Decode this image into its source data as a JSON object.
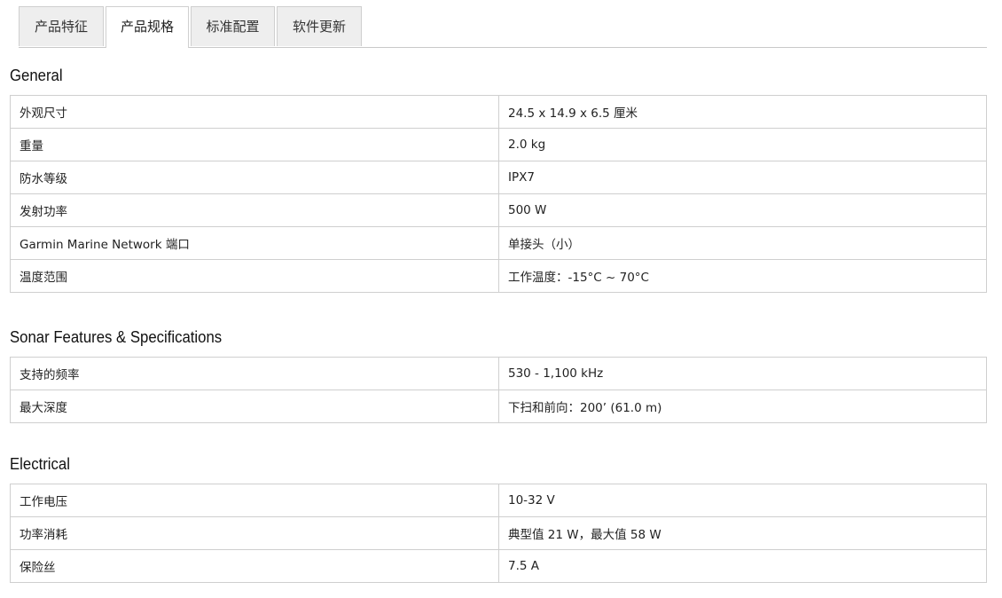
{
  "tabs": [
    {
      "label": "产品特征",
      "active": false
    },
    {
      "label": "产品规格",
      "active": true
    },
    {
      "label": "标准配置",
      "active": false
    },
    {
      "label": "软件更新",
      "active": false
    }
  ],
  "sections": [
    {
      "title": "General",
      "rows": [
        {
          "label": "外观尺寸",
          "value": "24.5 x 14.9 x 6.5 厘米"
        },
        {
          "label": "重量",
          "value": "2.0 kg"
        },
        {
          "label": "防水等级",
          "value": "IPX7"
        },
        {
          "label": "发射功率",
          "value": "500 W"
        },
        {
          "label": "Garmin Marine Network 端口",
          "value": "单接头（小）"
        },
        {
          "label": "温度范围",
          "value": "工作温度：-15°C ~ 70°C"
        }
      ]
    },
    {
      "title": "Sonar Features & Specifications",
      "rows": [
        {
          "label": "支持的频率",
          "value": "530 - 1,100 kHz"
        },
        {
          "label": "最大深度",
          "value": "下扫和前向：200’ (61.0 m)"
        }
      ]
    },
    {
      "title": "Electrical",
      "rows": [
        {
          "label": "工作电压",
          "value": "10-32 V"
        },
        {
          "label": "功率消耗",
          "value": "典型值 21 W，最大值 58 W"
        },
        {
          "label": "保险丝",
          "value": "7.5 A"
        }
      ]
    }
  ]
}
